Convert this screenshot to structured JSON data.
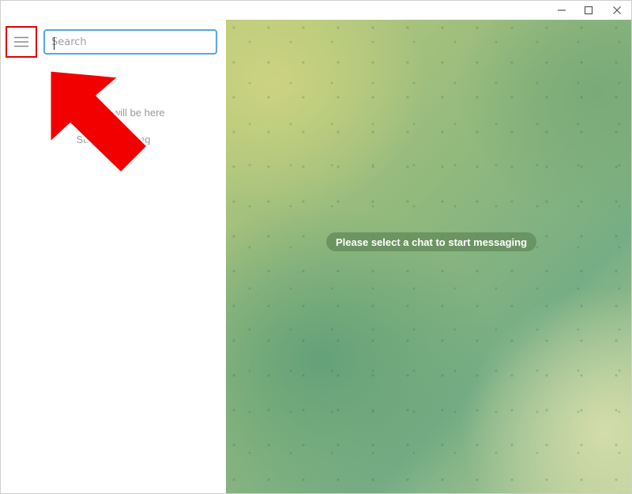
{
  "search": {
    "placeholder": "Search",
    "value": ""
  },
  "sidebar": {
    "empty_text": "Your chats will be here",
    "empty_subtext": "Start messaging"
  },
  "chat": {
    "hint": "Please select a chat to start messaging"
  },
  "icons": {
    "menu": "hamburger-icon",
    "minimize": "minimize-icon",
    "maximize": "maximize-icon",
    "close": "close-icon",
    "annotation": "arrow-icon"
  },
  "colors": {
    "search_border": "#57a7e0",
    "highlight": "#e10000",
    "hint_bg": "#608858"
  }
}
